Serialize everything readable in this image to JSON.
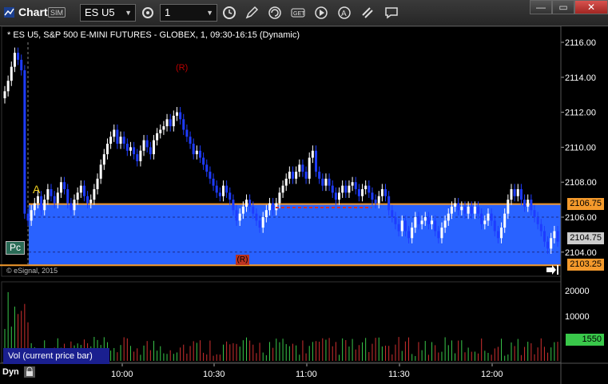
{
  "window": {
    "title": "Chart",
    "sim_badge": "SIM",
    "symbol_value": "ES U5",
    "interval_value": "1",
    "toolbar_icons": [
      "gear-icon",
      "clock-icon",
      "pencil-icon",
      "refresh-icon",
      "get-icon",
      "play-icon",
      "alert-icon",
      "link-icon",
      "speech-icon"
    ],
    "window_buttons": [
      "minimize-icon",
      "restore-icon",
      "close-icon"
    ]
  },
  "chart": {
    "title": "* ES U5, S&P 500 E-MINI FUTURES - GLOBEX, 1, 09:30-16:15 (Dynamic)",
    "copyright": "© eSignal, 2015",
    "price_ticks": [
      "2116.00",
      "2114.00",
      "2112.00",
      "2110.00",
      "2108.00",
      "2106.00",
      "2104.00"
    ],
    "time_ticks": [
      "10:00",
      "10:30",
      "11:00",
      "11:30",
      "12:00"
    ],
    "volume_ticks": [
      "20000",
      "10000"
    ],
    "tags": {
      "top": "2106.75",
      "last": "2104.75",
      "bottom": "2103.25",
      "volume": "1550"
    },
    "markers": {
      "a": "A",
      "r_top": "(R)",
      "r_bottom": "(R)",
      "pc": "Pc"
    },
    "volume_label": "Vol (current price bar)",
    "dyn_label": "Dyn",
    "colors": {
      "up_bar": "#ffffff",
      "down_bar": "#1e3cff",
      "band": "#2962ff",
      "band_line": "#f49a2c",
      "vol_up": "#39c84a",
      "vol_down": "#d03030"
    }
  },
  "chart_data": {
    "type": "candlestick",
    "x_axis_times": [
      "10:00",
      "10:30",
      "11:00",
      "11:30",
      "12:00"
    ],
    "ylim": [
      2103.0,
      2117.0
    ],
    "band": {
      "high": 2106.75,
      "low": 2103.25
    },
    "last": 2104.75,
    "closes": [
      2113.2,
      2113.8,
      2114.6,
      2115.4,
      2115.0,
      2114.4,
      2106.2,
      2105.8,
      2106.4,
      2106.8,
      2107.2,
      2106.4,
      2107.0,
      2107.6,
      2107.2,
      2106.8,
      2107.4,
      2108.0,
      2107.6,
      2106.8,
      2106.4,
      2107.0,
      2107.4,
      2107.8,
      2107.2,
      2106.8,
      2107.0,
      2107.6,
      2108.2,
      2109.0,
      2109.6,
      2110.2,
      2110.6,
      2111.0,
      2110.2,
      2110.6,
      2110.2,
      2109.8,
      2110.0,
      2109.6,
      2109.2,
      2109.8,
      2110.4,
      2110.0,
      2109.6,
      2110.4,
      2110.8,
      2111.0,
      2111.2,
      2111.6,
      2111.2,
      2111.8,
      2112.0,
      2111.6,
      2111.0,
      2110.6,
      2110.2,
      2109.6,
      2109.8,
      2109.4,
      2109.0,
      2108.6,
      2108.2,
      2107.8,
      2107.4,
      2107.2,
      2107.8,
      2107.4,
      2107.0,
      2106.4,
      2105.8,
      2106.2,
      2106.6,
      2107.0,
      2106.6,
      2106.2,
      2105.8,
      2105.4,
      2106.0,
      2106.4,
      2106.8,
      2106.4,
      2106.8,
      2107.4,
      2107.8,
      2108.2,
      2108.6,
      2108.2,
      2108.6,
      2109.0,
      2108.6,
      2108.2,
      2109.4,
      2109.8,
      2108.6,
      2108.2,
      2107.8,
      2108.2,
      2107.8,
      2107.4,
      2107.0,
      2107.4,
      2107.8,
      2107.4,
      2107.8,
      2108.0,
      2107.6,
      2107.2,
      2107.6,
      2107.8,
      2107.4,
      2107.0,
      2106.8,
      2107.2,
      2107.6,
      2107.2,
      2106.4,
      2106.0,
      2105.6,
      2105.2,
      2105.8,
      2105.2,
      2104.8,
      2105.4,
      2106.0,
      2105.6,
      2105.8,
      2106.0,
      2105.6,
      2105.8,
      2105.2,
      2104.8,
      2105.4,
      2105.8,
      2106.2,
      2106.6,
      2106.8,
      2106.4,
      2106.6,
      2106.2,
      2106.6,
      2106.2,
      2106.6,
      2106.2,
      2105.6,
      2105.8,
      2106.2,
      2105.8,
      2105.2,
      2104.8,
      2105.4,
      2106.2,
      2107.0,
      2107.6,
      2107.2,
      2107.6,
      2107.0,
      2106.6,
      2107.0,
      2106.4,
      2106.0,
      2105.6,
      2105.2,
      2104.6,
      2104.2,
      2104.8,
      2105.2,
      2104.6
    ]
  }
}
